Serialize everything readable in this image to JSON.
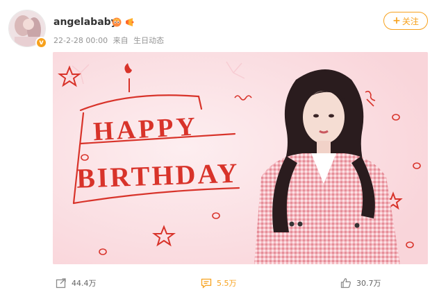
{
  "post": {
    "author": {
      "name": "angelababy",
      "verified_badge": "v",
      "badge_icons": [
        "vip-crown-icon",
        "fan-badge-icon"
      ]
    },
    "meta": {
      "time": "22-2-28 00:00",
      "source_prefix": "来自",
      "source": "生日动态"
    },
    "follow_button": {
      "label": "关注",
      "plus": "+"
    },
    "image": {
      "headline_line1": "HAPPY",
      "headline_line2": "BIRTHDAY"
    },
    "actions": {
      "repost": {
        "icon": "share-icon",
        "count": "44.4万"
      },
      "comment": {
        "icon": "comment-icon",
        "count": "5.5万"
      },
      "like": {
        "icon": "thumbs-up-icon",
        "count": "30.7万"
      }
    }
  },
  "colors": {
    "accent": "#f7a11c",
    "card_pink": "#fbdfe3",
    "headline_red": "#d8332a",
    "meta_gray": "#939393"
  }
}
